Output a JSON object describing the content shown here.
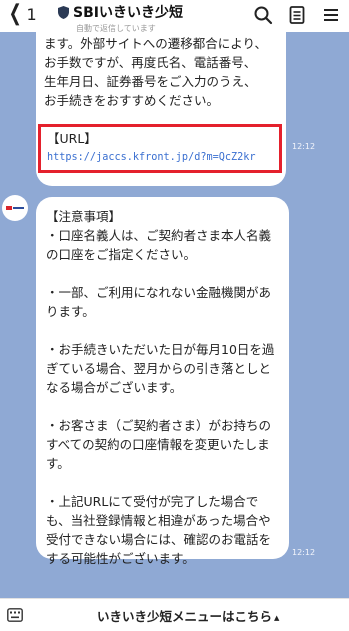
{
  "header": {
    "back_count": "1",
    "title": "SBIいきいき少短",
    "subtitle": "自動で返信しています"
  },
  "messages": [
    {
      "lines": [
        "ます。外部サイトへの遷移都合により、",
        "お手数ですが、再度氏名、電話番号、",
        "生年月日、証券番号をご入力のうえ、",
        "お手続きをおすすめください。"
      ],
      "url_label": "【URL】",
      "url": "https://jaccs.kfront.jp/d?m=QcZ2kr",
      "time": "12:12"
    },
    {
      "paragraphs": [
        "【注意事項】\n・口座名義人は、ご契約者さま本人名義の口座をご指定ください。",
        "・一部、ご利用になれない金融機関があります。",
        "・お手続きいただいた日が毎月10日を過ぎている場合、翌月からの引き落としとなる場合がございます。",
        "・お客さま（ご契約者さま）がお持ちのすべての契約の口座情報を変更いたします。",
        "・上記URLにて受付が完了した場合でも、当社登録情報と相違があった場合や受付できない場合には、確認のお電話をする可能性がございます。"
      ],
      "time": "12:12"
    }
  ],
  "bottom": {
    "menu_label": "いきいき少短メニューはこちら",
    "arrow": "▲"
  },
  "colors": {
    "chat_bg": "#8fa9d4",
    "highlight_border": "#e4202c",
    "link": "#3a6fd0"
  }
}
